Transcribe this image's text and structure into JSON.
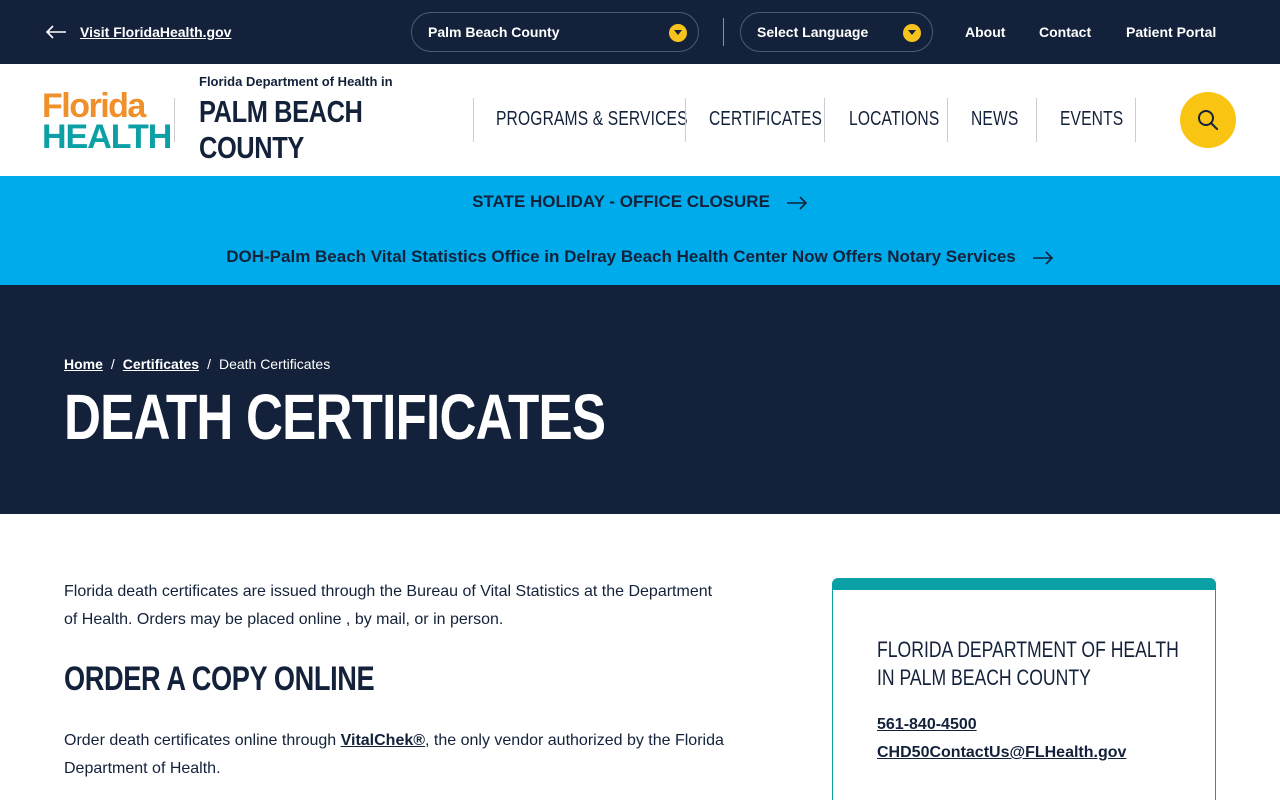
{
  "utility": {
    "back_link": "Visit FloridaHealth.gov",
    "county_select": "Palm Beach County",
    "language_select": "Select Language",
    "links": [
      "About",
      "Contact",
      "Patient Portal"
    ]
  },
  "header": {
    "logo_top": "Florida",
    "logo_bottom": "HEALTH",
    "dept": "Florida Department of Health in",
    "county_line1": "PALM BEACH",
    "county_line2": "COUNTY",
    "nav": [
      "PROGRAMS & SERVICES",
      "CERTIFICATES",
      "LOCATIONS",
      "NEWS",
      "EVENTS"
    ],
    "search_icon": "search-icon"
  },
  "alerts": [
    "STATE HOLIDAY - OFFICE CLOSURE",
    "DOH-Palm Beach Vital Statistics Office in Delray Beach Health Center Now Offers Notary Services"
  ],
  "hero": {
    "breadcrumb": [
      "Home",
      "Certificates",
      "Death Certificates"
    ],
    "title": "DEATH CERTIFICATES"
  },
  "content": {
    "intro": "Florida death certificates are issued through the Bureau of Vital Statistics at the Department of Health. Orders may be placed online , by mail, or in person.",
    "section_heading": "ORDER A COPY ONLINE",
    "order_before": "Order death certificates online through ",
    "order_link": "VitalChek®",
    "order_after": ", the only vendor authorized by the Florida Department of Health."
  },
  "contact_card": {
    "title": "Florida Department of Health in Palm Beach County",
    "phone": "561-840-4500",
    "email": "CHD50ContactUs@FLHealth.gov"
  },
  "colors": {
    "navy": "#13223a",
    "accent_yellow": "#f9c412",
    "alert_blue": "#00abeb",
    "teal": "#0b9fa6",
    "orange": "#f0902a"
  }
}
